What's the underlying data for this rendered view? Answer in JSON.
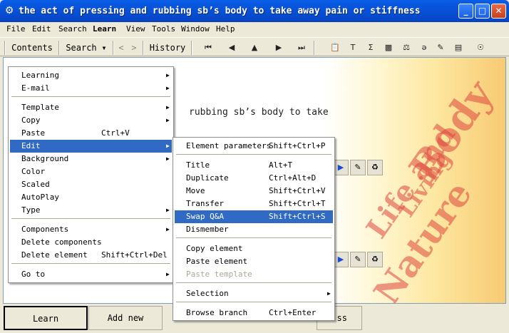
{
  "window": {
    "title": "the act of pressing and rubbing sb’s body to take away pain or stiffness",
    "icon": "app-icon",
    "controls": [
      "_",
      "□",
      "✕"
    ]
  },
  "menubar": [
    "File",
    "Edit",
    "Search",
    "Learn",
    "View",
    "Tools",
    "Window",
    "Help"
  ],
  "toolbar": {
    "contents": "Contents",
    "search": "Search",
    "search_arrow": "▾",
    "back": "<",
    "forward": ">",
    "history": "History"
  },
  "content": {
    "text": "rubbing sb’s body to take",
    "art_words": [
      "Body",
      "Life and",
      "Living",
      "Nature"
    ]
  },
  "bottom": {
    "learn": "Learn",
    "add_new": "Add new",
    "partial": "ss"
  },
  "learn_menu": {
    "items": [
      {
        "label": "Learning",
        "shortcut": "",
        "submenu": true
      },
      {
        "label": "E-mail",
        "shortcut": "",
        "submenu": true
      },
      {
        "label": "Template",
        "shortcut": "",
        "submenu": true
      },
      {
        "label": "Copy",
        "shortcut": "",
        "submenu": true
      },
      {
        "label": "Paste",
        "shortcut": "Ctrl+V",
        "submenu": false
      },
      {
        "label": "Edit",
        "shortcut": "",
        "submenu": true
      },
      {
        "label": "Background",
        "shortcut": "",
        "submenu": true
      },
      {
        "label": "Color",
        "shortcut": "",
        "submenu": false
      },
      {
        "label": "Scaled",
        "shortcut": "",
        "submenu": false
      },
      {
        "label": "AutoPlay",
        "shortcut": "",
        "submenu": false
      },
      {
        "label": "Type",
        "shortcut": "",
        "submenu": true
      },
      {
        "label": "Components",
        "shortcut": "",
        "submenu": true
      },
      {
        "label": "Delete components",
        "shortcut": "",
        "submenu": false
      },
      {
        "label": "Delete element",
        "shortcut": "Shift+Ctrl+Del",
        "submenu": false
      },
      {
        "label": "Go to",
        "shortcut": "",
        "submenu": true
      }
    ]
  },
  "edit_menu": {
    "items": [
      {
        "label": "Element parameters",
        "shortcut": "Shift+Ctrl+P"
      },
      {
        "label": "Title",
        "shortcut": "Alt+T"
      },
      {
        "label": "Duplicate",
        "shortcut": "Ctrl+Alt+D"
      },
      {
        "label": "Move",
        "shortcut": "Shift+Ctrl+V"
      },
      {
        "label": "Transfer",
        "shortcut": "Shift+Ctrl+T"
      },
      {
        "label": "Swap Q&A",
        "shortcut": "Shift+Ctrl+S"
      },
      {
        "label": "Dismember",
        "shortcut": ""
      },
      {
        "label": "Copy element",
        "shortcut": ""
      },
      {
        "label": "Paste element",
        "shortcut": ""
      },
      {
        "label": "Paste template",
        "shortcut": ""
      },
      {
        "label": "Selection",
        "shortcut": ""
      },
      {
        "label": "Browse branch",
        "shortcut": "Ctrl+Enter"
      }
    ]
  }
}
